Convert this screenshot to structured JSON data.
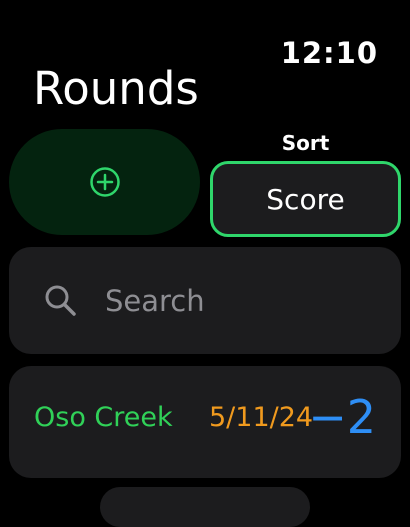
{
  "status": {
    "time": "12:10"
  },
  "header": {
    "title": "Rounds"
  },
  "add_button": {
    "icon": "plus-circle-icon",
    "color": "#2fd66b"
  },
  "sort": {
    "label": "Sort",
    "value": "Score",
    "accent": "#2fd66b"
  },
  "search": {
    "placeholder": "Search",
    "icon": "magnifying-glass-icon"
  },
  "rounds": [
    {
      "course": "Oso Creek",
      "date": "5/11/24",
      "score": "−2"
    }
  ],
  "colors": {
    "background": "#000000",
    "card": "#1c1c1e",
    "course": "#30d158",
    "date": "#f09a1e",
    "score": "#2e8ef5"
  }
}
